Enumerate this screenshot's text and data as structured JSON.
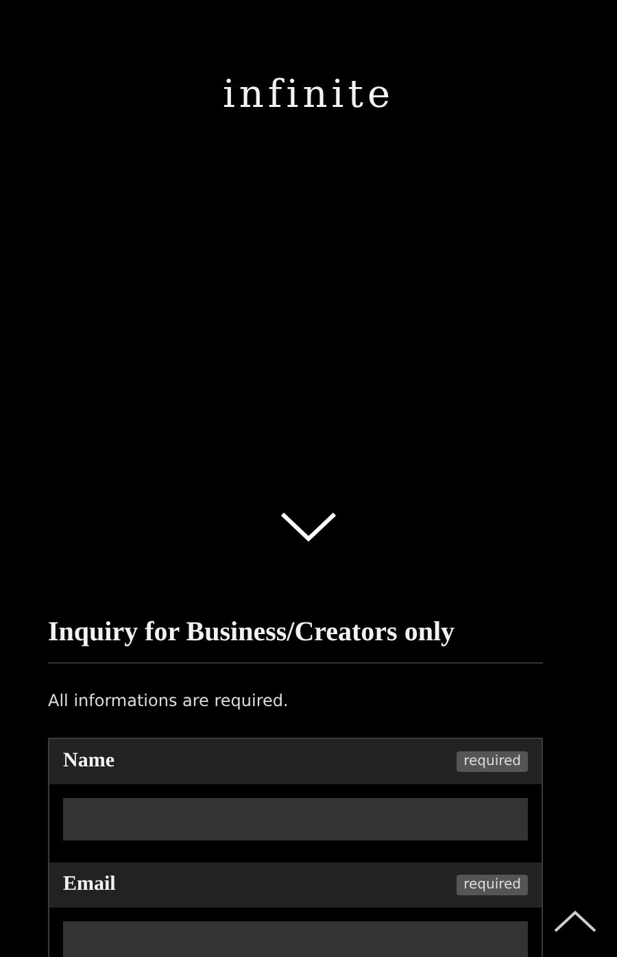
{
  "logo": "infinite",
  "section": {
    "title": "Inquiry for Business/Creators only",
    "note": "All informations are required."
  },
  "fields": [
    {
      "label": "Name",
      "badge": "required"
    },
    {
      "label": "Email",
      "badge": "required"
    }
  ]
}
